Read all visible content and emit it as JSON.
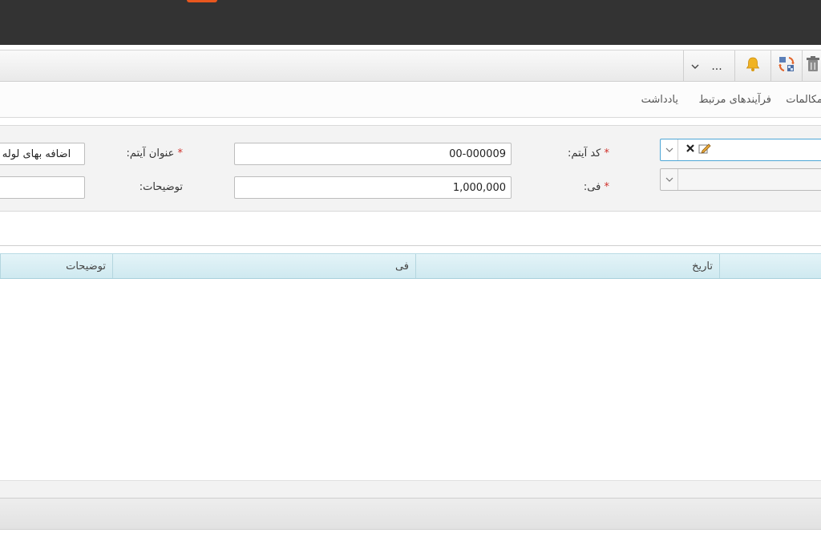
{
  "toolbar": {
    "more_label": "...",
    "icons": [
      "trash-icon",
      "refresh-swap-icon",
      "bell-icon",
      "more-icon",
      "chevron-down-icon"
    ]
  },
  "tabs": [
    {
      "label": "مکالمات"
    },
    {
      "label": "فرآیندهای مرتبط"
    },
    {
      "label": "یادداشت"
    }
  ],
  "form": {
    "item_code_label": "کد آیتم:",
    "item_code_value": "00-000009",
    "item_title_label": "عنوان آیتم:",
    "item_title_value": "اضافه بهای لوله گ",
    "fee_label": "فی:",
    "fee_value": "1,000,000",
    "description_label": "توضیحات:",
    "description_value": "",
    "required_mark": "*"
  },
  "grid": {
    "columns": [
      {
        "label": "تاریخ"
      },
      {
        "label": "فی"
      },
      {
        "label": "توضیحات"
      }
    ],
    "rows": []
  },
  "colors": {
    "topbar": "#333333",
    "accent": "#e8571e",
    "grid_header": "#d5ecf2",
    "required": "#d0302a"
  }
}
